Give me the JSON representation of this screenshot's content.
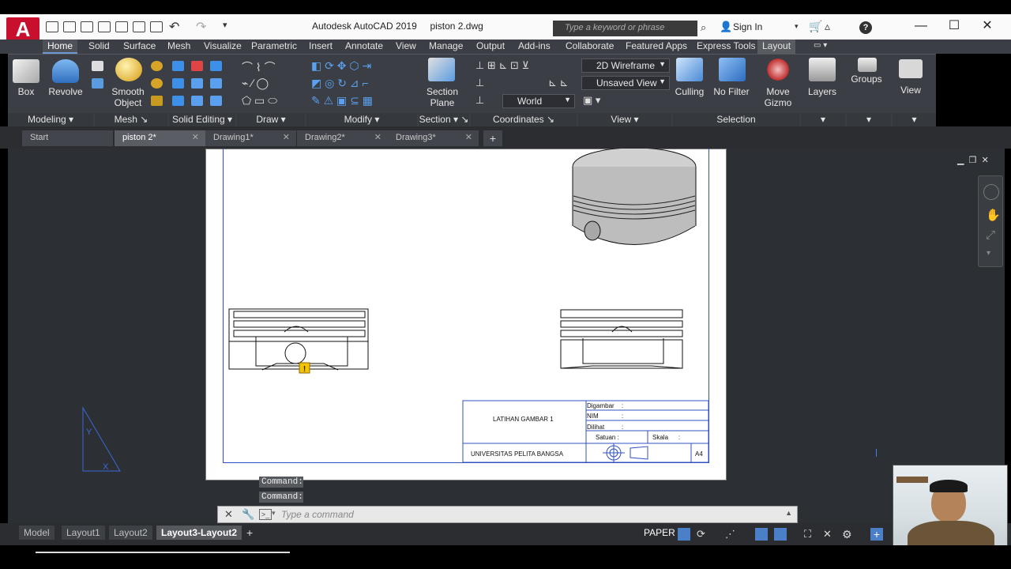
{
  "app": {
    "title": "Autodesk AutoCAD 2019",
    "file": "piston 2.dwg",
    "logo_letter": "A"
  },
  "search": {
    "placeholder": "Type a keyword or phrase"
  },
  "account": {
    "signin": "Sign In"
  },
  "ribbon_tabs": [
    "Home",
    "Solid",
    "Surface",
    "Mesh",
    "Visualize",
    "Parametric",
    "Insert",
    "Annotate",
    "View",
    "Manage",
    "Output",
    "Add-ins",
    "Collaborate",
    "Featured Apps",
    "Express Tools",
    "Layout"
  ],
  "ribbon": {
    "buttons": {
      "box": "Box",
      "revolve": "Revolve",
      "smooth_object": "Smooth\nObject",
      "section_plane": "Section\nPlane",
      "culling": "Culling",
      "no_filter": "No Filter",
      "move_gizmo": "Move\nGizmo",
      "layers": "Layers",
      "groups": "Groups",
      "view": "View"
    },
    "combos": {
      "visual_style": "2D Wireframe",
      "view": "Unsaved View",
      "ucs": "World"
    },
    "panels": {
      "modeling": "Modeling",
      "mesh": "Mesh",
      "solid_editing": "Solid Editing",
      "draw": "Draw",
      "modify": "Modify",
      "section": "Section",
      "coordinates": "Coordinates",
      "view": "View",
      "selection": "Selection"
    }
  },
  "doc_tabs": [
    {
      "label": "Start"
    },
    {
      "label": "piston 2*"
    },
    {
      "label": "Drawing1*"
    },
    {
      "label": "Drawing2*"
    },
    {
      "label": "Drawing3*"
    }
  ],
  "title_block": {
    "exercise": "LATIHAN GAMBAR 1",
    "university": "UNIVERSITAS PELITA BANGSA",
    "digambar": "Digambar",
    "nim": "NIM",
    "dilihat": "Dilihat",
    "satuan": "Satuan :",
    "skala": "Skala",
    "colon": ":",
    "paper_size": "A4"
  },
  "command": {
    "history": [
      "Command:",
      "Command:"
    ],
    "placeholder": "Type a command"
  },
  "layout_tabs": [
    "Model",
    "Layout1",
    "Layout2",
    "Layout3-Layout2"
  ],
  "status": {
    "space": "PAPER"
  },
  "colors": {
    "ribbon_bg": "#3b3e44",
    "accent_blue": "#3050c0",
    "logo_red": "#c8102e",
    "warning_yellow": "#f5c400"
  }
}
